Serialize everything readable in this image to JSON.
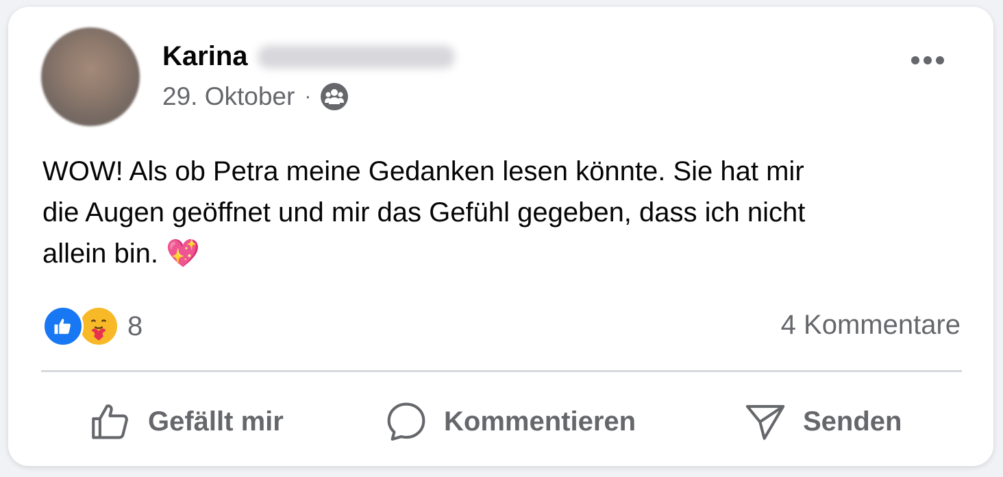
{
  "post": {
    "author_name": "Karina",
    "date": "29. Oktober",
    "separator": "·",
    "audience_icon": "group-icon",
    "text_line_1": "WOW! Als ob Petra meine Gedanken lesen könnte. Sie hat mir",
    "text_line_2": "die Augen geöffnet und mir das Gefühl gegeben, dass ich nicht",
    "text_line_3": "allein bin.",
    "emoji": "💖"
  },
  "reactions": {
    "types": [
      "like-icon",
      "care-icon"
    ],
    "count": "8"
  },
  "comments": {
    "label": "4 Kommentare"
  },
  "actions": {
    "like_label": "Gefällt mir",
    "comment_label": "Kommentieren",
    "send_label": "Senden"
  },
  "colors": {
    "primary_text": "#050505",
    "secondary_text": "#65676b",
    "like_blue": "#1877f2",
    "care_yellow": "#f7b928"
  }
}
